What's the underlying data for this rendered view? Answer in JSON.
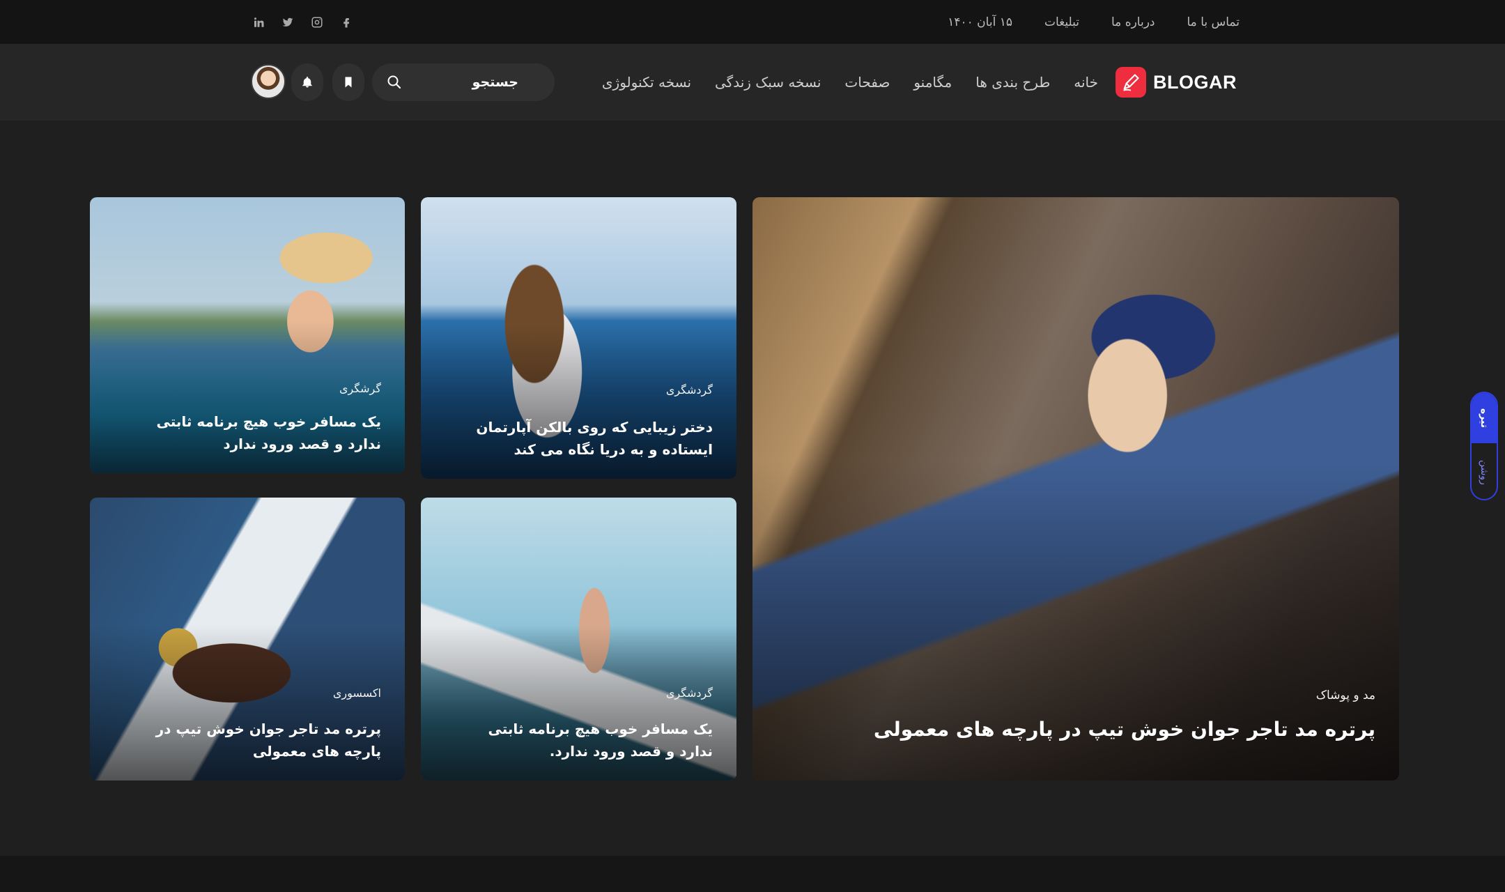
{
  "topbar": {
    "date": "۱۵ آبان ۱۴۰۰",
    "links": [
      "تبلیغات",
      "درباره ما",
      "تماس با ما"
    ],
    "social": [
      "facebook-icon",
      "instagram-icon",
      "twitter-icon",
      "linkedin-icon"
    ]
  },
  "header": {
    "logo_text": "BLOGAR",
    "nav": [
      "خانه",
      "طرح بندی ها",
      "مگامنو",
      "صفحات",
      "نسخه سبک زندگی",
      "نسخه تکنولوژی"
    ],
    "search_placeholder": "جستجو"
  },
  "cards": {
    "main": {
      "category": "مد و پوشاک",
      "title": "پرتره مد تاجر جوان خوش تیپ در پارچه های معمولی"
    },
    "top_center": {
      "category": "گردشگری",
      "title": "دختر زیبایی که روی بالکن آپارتمان ایستاده و به دریا نگاه می کند"
    },
    "top_left": {
      "category": "گرشگری",
      "title": "یک مسافر خوب هیچ برنامه ثابتی ندارد و قصد ورود ندارد"
    },
    "bottom_center": {
      "category": "گردشگری",
      "title": "یک مسافر خوب هیچ برنامه ثابتی ندارد و قصد ورود ندارد."
    },
    "bottom_left": {
      "category": "اکسسوری",
      "title": "پرتره مد تاجر جوان خوش تیپ در پارچه های معمولی"
    }
  },
  "side_toggle": {
    "active": "تیره",
    "inactive": "روشن"
  },
  "colors": {
    "accent": "#ee2d3f",
    "toggle": "#2f3fe0",
    "background": "#1f1f1f"
  }
}
